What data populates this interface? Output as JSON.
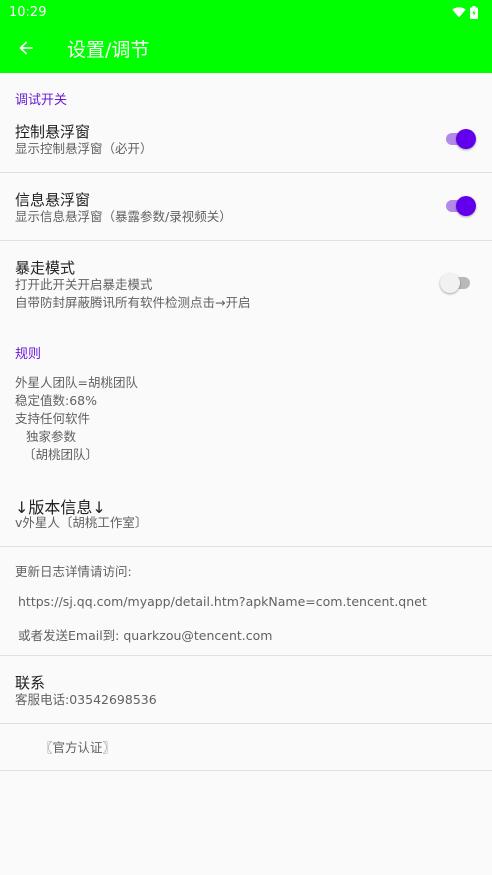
{
  "status_bar": {
    "time": "10:29"
  },
  "toolbar": {
    "title": "设置/调节"
  },
  "debug_section": {
    "header": "调试开关",
    "prefs": [
      {
        "title": "控制悬浮窗",
        "summary": "显示控制悬浮窗（必开）",
        "enabled": true
      },
      {
        "title": "信息悬浮窗",
        "summary": "显示信息悬浮窗（暴露参数/录视频关）",
        "enabled": true
      },
      {
        "title": "暴走模式",
        "summary_line1": "打开此开关开启暴走模式",
        "summary_line2": "自带防封屏蔽腾讯所有软件检测点击→开启",
        "enabled": false
      }
    ]
  },
  "rules_section": {
    "header": "规则",
    "lines": [
      "外星人团队=胡桃团队",
      "稳定值数:68%",
      "支持任何软件",
      "独家参数",
      "〔胡桃团队〕"
    ]
  },
  "version": {
    "title": "↓版本信息↓",
    "summary": "v外星人〔胡桃工作室〕"
  },
  "update_log": {
    "label": "更新日志详情请访问:",
    "url": "https://sj.qq.com/myapp/detail.htm?apkName=com.tencent.qnet",
    "email_line": "或者发送Email到: quarkzou@tencent.com"
  },
  "contact": {
    "title": "联系",
    "summary": "客服电话:03542698536"
  },
  "official": {
    "label": "〖官方认证〗"
  },
  "colors": {
    "appbar": "#00ff00",
    "accent": "#6200ee",
    "section_header": "#6a1bd6"
  }
}
